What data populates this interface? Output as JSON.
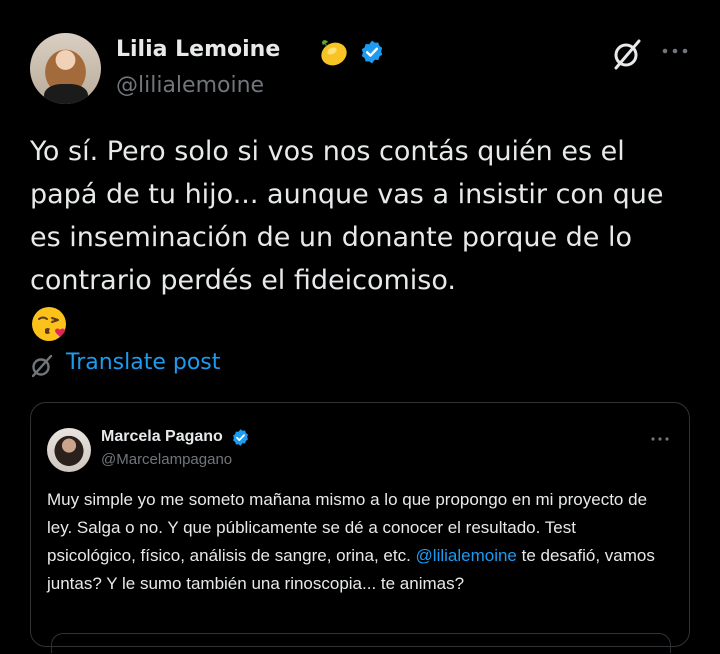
{
  "post": {
    "author": {
      "display_name": "Lilia Lemoine",
      "handle": "@lilialemoine",
      "badge_emoji": "lemon-icon",
      "verified": true
    },
    "text": "Yo sí. Pero solo si vos nos contás quién es el\npapá de tu hijo... aunque vas a insistir con que\nes inseminación de un donante porque de lo\ncontrario perdés el fideicomiso.",
    "emoji": "face-blowing-a-kiss",
    "translate_label": "Translate post"
  },
  "quoted_post": {
    "author": {
      "display_name": "Marcela Pagano",
      "handle": "@Marcelampagano",
      "verified": true
    },
    "text_before_mention": "Muy simple yo me someto mañana mismo a lo que propongo en mi proyecto de ley. Salga o no. Y que públicamente se dé a conocer el resultado. Test psicológico, físico, análisis de sangre, orina, etc. ",
    "mention": "@lilialemoine",
    "text_after_mention": " te desafió, vamos juntas? Y le sumo también una rinoscopia... te animas?"
  },
  "colors": {
    "background": "#000000",
    "text": "#e7e9ea",
    "secondary": "#71767b",
    "link": "#1d9bf0",
    "border": "#2f3336",
    "verified": "#1d9bf0"
  }
}
